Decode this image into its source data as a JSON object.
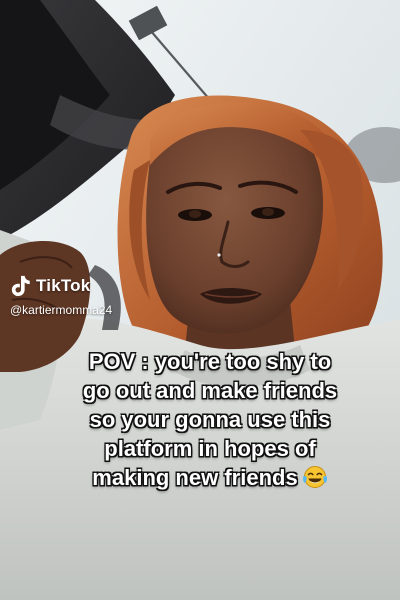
{
  "watermark": {
    "brand": "TikTok",
    "handle": "@kartiermomma24",
    "logo_icon": "tiktok-note-icon"
  },
  "caption": {
    "lines": [
      "POV : you're too shy to",
      "go out and make friends",
      "so your gonna use this",
      "platform in hopes of",
      "making new friends"
    ],
    "emoji": "face-with-tears-of-joy-icon"
  },
  "colors": {
    "hair": "#c46a38",
    "skin": "#6e4330",
    "sky": "#e6ecef",
    "jacket": "#d5d8d5",
    "car_interior": "#2a2a2c",
    "caption_text": "#ffffff"
  }
}
